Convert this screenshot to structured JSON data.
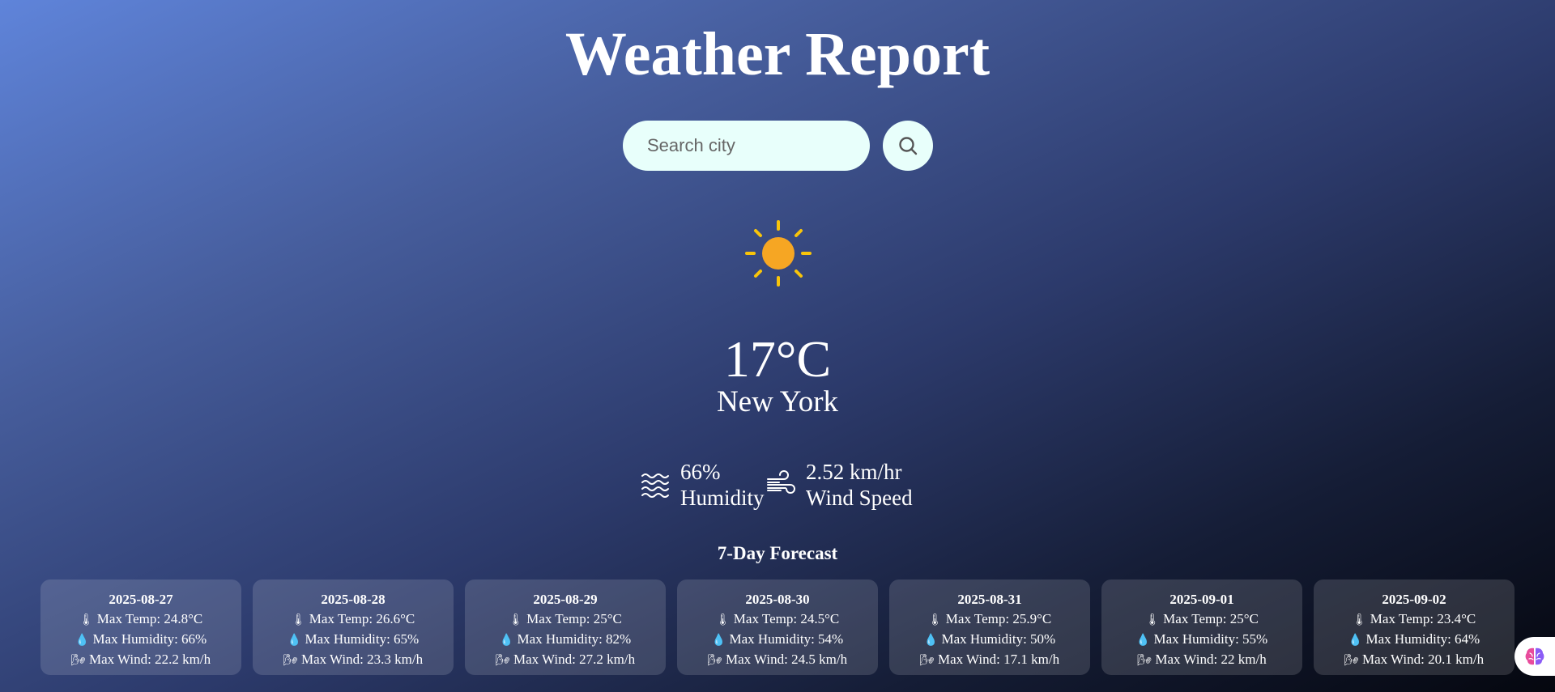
{
  "header": {
    "title": "Weather Report"
  },
  "search": {
    "placeholder": "Search city",
    "value": ""
  },
  "current": {
    "icon": "sun-icon",
    "temperature": "17°C",
    "city": "New York",
    "humidity_value": "66%",
    "humidity_label": "Humidity",
    "wind_value": "2.52 km/hr",
    "wind_label": "Wind Speed"
  },
  "forecast": {
    "title": "7-Day Forecast",
    "days": [
      {
        "date": "2025-08-27",
        "max_temp": "Max Temp: 24.8°C",
        "max_humidity": "Max Humidity: 66%",
        "max_wind": "Max Wind: 22.2 km/h"
      },
      {
        "date": "2025-08-28",
        "max_temp": "Max Temp: 26.6°C",
        "max_humidity": "Max Humidity: 65%",
        "max_wind": "Max Wind: 23.3 km/h"
      },
      {
        "date": "2025-08-29",
        "max_temp": "Max Temp: 25°C",
        "max_humidity": "Max Humidity: 82%",
        "max_wind": "Max Wind: 27.2 km/h"
      },
      {
        "date": "2025-08-30",
        "max_temp": "Max Temp: 24.5°C",
        "max_humidity": "Max Humidity: 54%",
        "max_wind": "Max Wind: 24.5 km/h"
      },
      {
        "date": "2025-08-31",
        "max_temp": "Max Temp: 25.9°C",
        "max_humidity": "Max Humidity: 50%",
        "max_wind": "Max Wind: 17.1 km/h"
      },
      {
        "date": "2025-09-01",
        "max_temp": "Max Temp: 25°C",
        "max_humidity": "Max Humidity: 55%",
        "max_wind": "Max Wind: 22 km/h"
      },
      {
        "date": "2025-09-02",
        "max_temp": "Max Temp: 23.4°C",
        "max_humidity": "Max Humidity: 64%",
        "max_wind": "Max Wind: 20.1 km/h"
      }
    ]
  },
  "icons": {
    "thermometer": "thermometer-icon",
    "droplet": "droplet-icon",
    "wind": "wind-icon",
    "brain": "brain-icon"
  },
  "colors": {
    "sun": "#f6a623",
    "sun_rays": "#f8c40a",
    "search_bg": "#e8fffb"
  }
}
